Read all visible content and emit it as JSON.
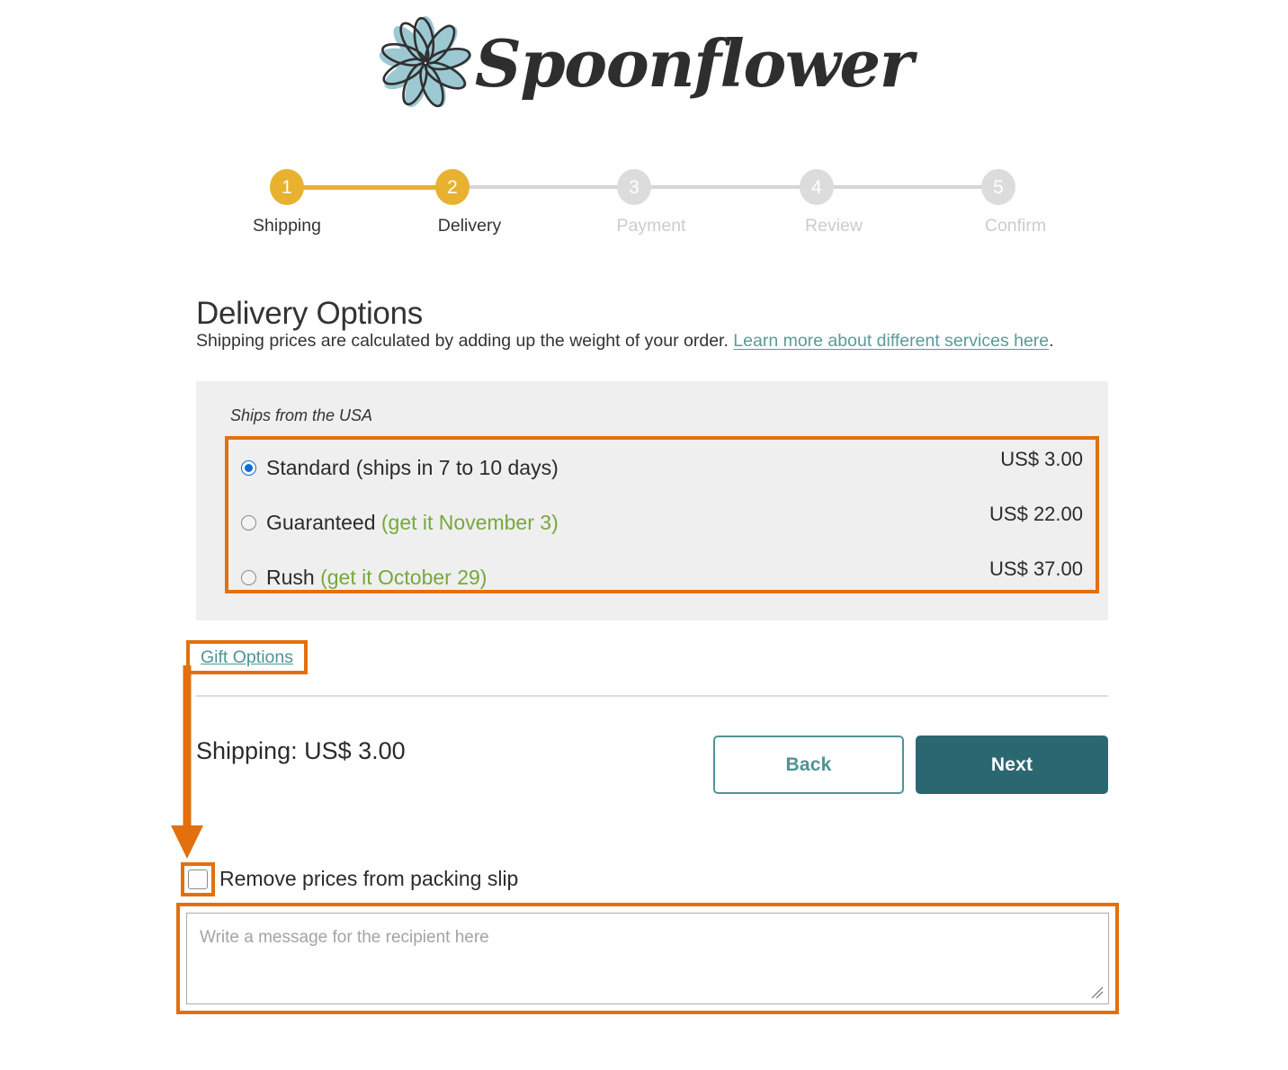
{
  "brand": {
    "name": "Spoonflower",
    "logo_icon": "flower-icon",
    "flower_color": "#9cc8d2",
    "text_color": "#2e2e2e"
  },
  "stepper": {
    "active_index": 1,
    "accent_color": "#e8b130",
    "inactive_color": "#dcdcdc",
    "steps": [
      {
        "number": "1",
        "label": "Shipping",
        "state": "complete"
      },
      {
        "number": "2",
        "label": "Delivery",
        "state": "active"
      },
      {
        "number": "3",
        "label": "Payment",
        "state": "pending"
      },
      {
        "number": "4",
        "label": "Review",
        "state": "pending"
      },
      {
        "number": "5",
        "label": "Confirm",
        "state": "pending"
      }
    ]
  },
  "page": {
    "title": "Delivery Options",
    "subtitle_prefix": "Shipping prices are calculated by adding up the weight of your order. ",
    "subtitle_link": "Learn more about different services here",
    "subtitle_suffix": ".",
    "link_color": "#5b9a9a"
  },
  "delivery": {
    "ships_from": "Ships from the USA",
    "panel_bg": "#efefef",
    "eta_color": "#78a83c",
    "options": [
      {
        "name": "Standard",
        "detail": " (ships in 7 to 10 days)",
        "detail_style": "plain",
        "price": "US$ 3.00",
        "selected": true
      },
      {
        "name": "Guaranteed",
        "detail": " (get it November 3)",
        "detail_style": "eta",
        "price": "US$ 22.00",
        "selected": false
      },
      {
        "name": "Rush",
        "detail": " (get it October 29)",
        "detail_style": "eta",
        "price": "US$ 37.00",
        "selected": false
      }
    ]
  },
  "gift": {
    "link_label": "Gift Options",
    "checkbox_label": "Remove prices from packing slip",
    "checkbox_checked": false,
    "message_value": "",
    "message_placeholder": "Write a message for the recipient here"
  },
  "footer": {
    "shipping_total": "Shipping: US$ 3.00",
    "back_label": "Back",
    "next_label": "Next",
    "back_color": "#4f9496",
    "next_bg": "#2a6771"
  },
  "annotations": {
    "highlight_color": "#e2700e",
    "arrow_from": "Gift Options",
    "arrow_to": "Remove prices from packing slip checkbox"
  }
}
